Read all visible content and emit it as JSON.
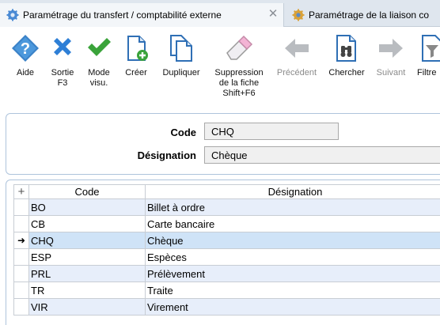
{
  "tabs": [
    {
      "label": "Paramétrage du transfert / comptabilité externe",
      "icon": "settings-gear-icon",
      "active": true
    },
    {
      "label": "Paramétrage de la liaison co",
      "icon": "settings-gear-icon",
      "active": false
    }
  ],
  "toolbar": {
    "aide": "Aide",
    "sortie": "Sortie\nF3",
    "mode": "Mode\nvisu.",
    "creer": "Créer",
    "dupliquer": "Dupliquer",
    "suppression": "Suppression\nde la fiche\nShift+F6",
    "precedent": "Précédent",
    "chercher": "Chercher",
    "suivant": "Suivant",
    "filtre": "Filtre"
  },
  "form": {
    "code_label": "Code",
    "code_value": "CHQ",
    "designation_label": "Désignation",
    "designation_value": "Chèque"
  },
  "grid": {
    "headers": {
      "code": "Code",
      "designation": "Désignation"
    },
    "selected_marker": "➜",
    "rows": [
      {
        "code": "BO",
        "designation": "Billet à ordre"
      },
      {
        "code": "CB",
        "designation": "Carte bancaire"
      },
      {
        "code": "CHQ",
        "designation": "Chèque"
      },
      {
        "code": "ESP",
        "designation": "Espèces"
      },
      {
        "code": "PRL",
        "designation": "Prélèvement"
      },
      {
        "code": "TR",
        "designation": "Traite"
      },
      {
        "code": "VIR",
        "designation": "Virement"
      }
    ]
  },
  "colors": {
    "accent": "#2f8fdc",
    "selected_row": "#cfe3f7",
    "alt_row": "#e7eefa",
    "green_check": "#3aa33a",
    "blue_cross": "#2e7fd6"
  }
}
